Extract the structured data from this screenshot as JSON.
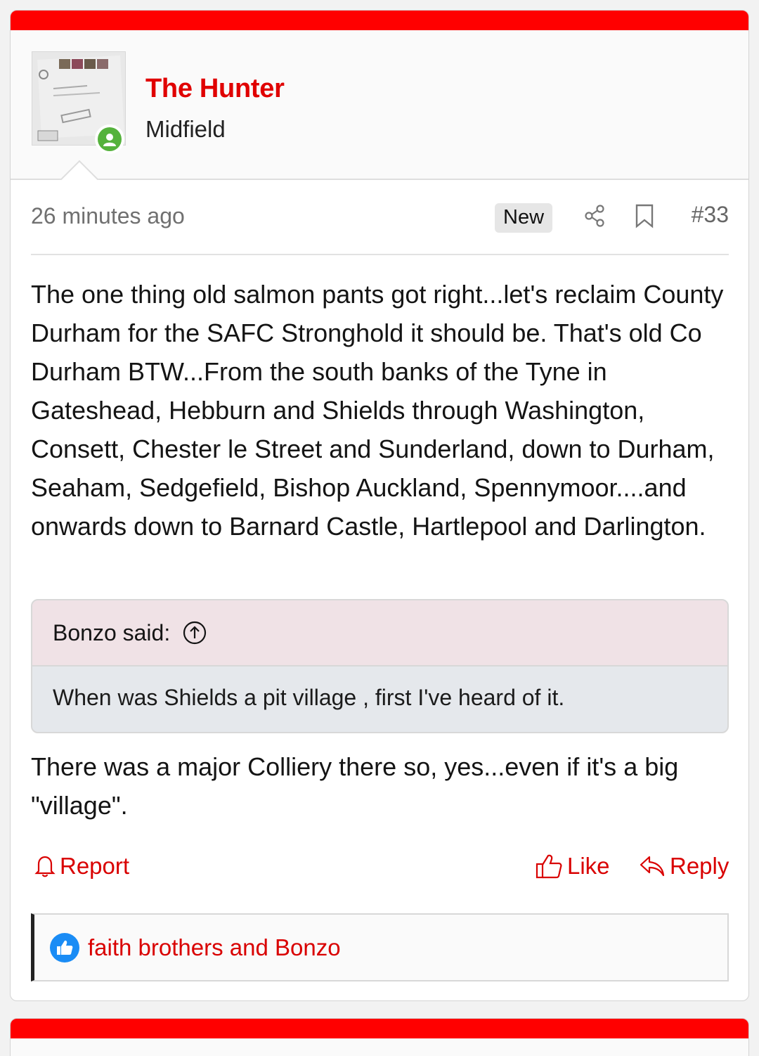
{
  "post": {
    "author": {
      "name": "The Hunter",
      "title": "Midfield",
      "online": true
    },
    "meta": {
      "timestamp": "26 minutes ago",
      "badge": "New",
      "post_number": "#33"
    },
    "body_paragraph": "The one thing old salmon pants got right...let's reclaim County Durham for the SAFC Stronghold it should be. That's old Co Durham BTW...From the south banks of the Tyne in Gateshead, Hebburn and Shields through Washington, Consett, Chester le Street and Sunderland, down to Durham, Seaham, Sedgefield, Bishop Auckland, Spennymoor....and onwards down to Barnard Castle, Hartlepool and Darlington.",
    "quote": {
      "header": "Bonzo said:",
      "text": "When was Shields a pit village , first I've heard of it."
    },
    "reply_paragraph": "There was a major Colliery there so, yes...even if it's a big \"village\".",
    "actions": {
      "report": "Report",
      "like": "Like",
      "reply": "Reply"
    },
    "reactions": {
      "users": "faith brothers and Bonzo"
    }
  },
  "colors": {
    "accent": "#ff0000",
    "link": "#d90000",
    "online": "#55b23c",
    "like_bubble": "#1a8cf5"
  },
  "icons": [
    "share-icon",
    "bookmark-icon",
    "arrow-up-circle-icon",
    "bell-icon",
    "thumbs-up-icon",
    "reply-icon",
    "online-user-icon"
  ]
}
